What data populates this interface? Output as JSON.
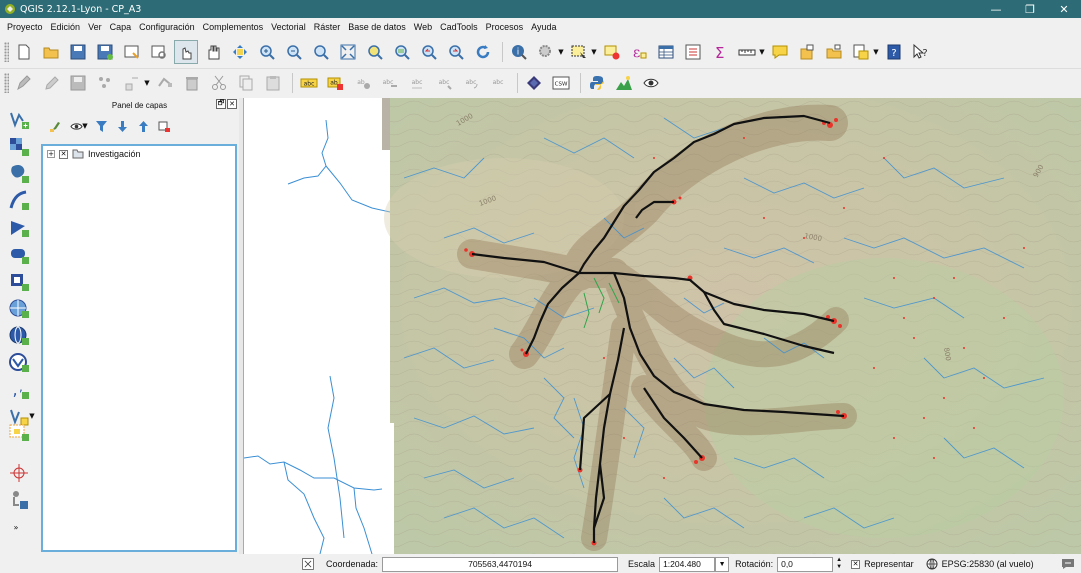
{
  "window": {
    "title": "QGIS 2.12.1-Lyon - CP_A3",
    "minimize": "—",
    "maximize": "❐",
    "close": "✕"
  },
  "menubar": [
    "Proyecto",
    "Edición",
    "Ver",
    "Capa",
    "Configuración",
    "Complementos",
    "Vectorial",
    "Ráster",
    "Base de datos",
    "Web",
    "CadTools",
    "Procesos",
    "Ayuda"
  ],
  "toolbar2": {
    "label_abc": "abc",
    "label_ab": "ab",
    "csw": "CSW"
  },
  "layers_panel": {
    "title": "Panel de capas",
    "float_btn": "🗗",
    "close_btn": "✕",
    "layers": [
      {
        "name": "Investigación",
        "checked": "✕",
        "expand": "+"
      }
    ]
  },
  "map": {
    "contour_labels": [
      "1000",
      "900",
      "1000",
      "800",
      "1000"
    ]
  },
  "statusbar": {
    "coord_label": "Coordenada:",
    "coord_value": "705563,4470194",
    "scale_label": "Escala",
    "scale_value": "1:204.480",
    "rotation_label": "Rotación:",
    "rotation_value": "0,0",
    "render_label": "Representar",
    "render_checked": "✕",
    "crs_label": "EPSG:25830 (al vuelo)"
  },
  "colors": {
    "titlebar": "#2d6c76",
    "river_blue": "#3b8fd4",
    "path_black": "#111111",
    "points_red": "#e8352b",
    "selection_blue": "#6aaedc"
  }
}
